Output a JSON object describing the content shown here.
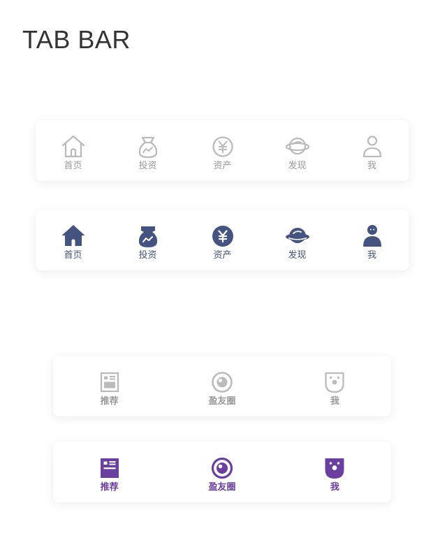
{
  "header": {
    "title": "TAB BAR"
  },
  "colors": {
    "inactive": "#bbbbbb",
    "inactive_label": "#9a9a9a",
    "active_navy": "#44537f",
    "active_purple": "#6a3fa0"
  },
  "tabbar_main_inactive": {
    "items": [
      {
        "label": "首页",
        "icon": "home-icon"
      },
      {
        "label": "投资",
        "icon": "money-bag-icon"
      },
      {
        "label": "资产",
        "icon": "yen-coin-icon"
      },
      {
        "label": "发现",
        "icon": "planet-icon"
      },
      {
        "label": "我",
        "icon": "person-icon"
      }
    ]
  },
  "tabbar_main_active": {
    "items": [
      {
        "label": "首页",
        "icon": "home-icon"
      },
      {
        "label": "投资",
        "icon": "money-bag-icon"
      },
      {
        "label": "资产",
        "icon": "yen-coin-icon"
      },
      {
        "label": "发现",
        "icon": "planet-icon"
      },
      {
        "label": "我",
        "icon": "person-icon"
      }
    ]
  },
  "tabbar_social_inactive": {
    "items": [
      {
        "label": "推荐",
        "icon": "news-card-icon"
      },
      {
        "label": "盈友圈",
        "icon": "circle-target-icon"
      },
      {
        "label": "我",
        "icon": "face-badge-icon"
      }
    ]
  },
  "tabbar_social_active": {
    "items": [
      {
        "label": "推荐",
        "icon": "news-card-icon"
      },
      {
        "label": "盈友圈",
        "icon": "circle-target-icon"
      },
      {
        "label": "我",
        "icon": "face-badge-icon"
      }
    ]
  }
}
